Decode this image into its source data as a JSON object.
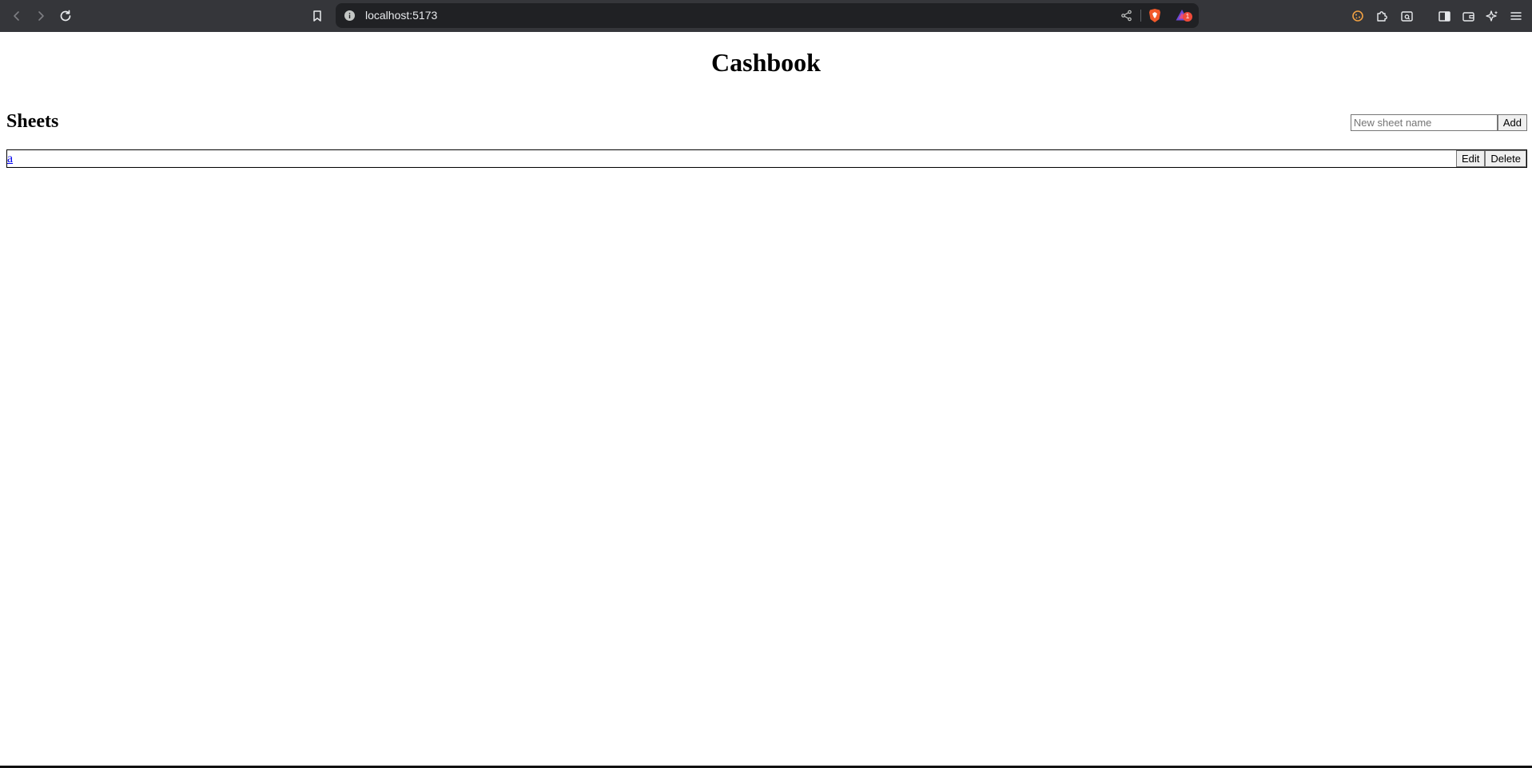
{
  "browser": {
    "url": "localhost:5173",
    "notification_count": "1"
  },
  "app": {
    "title": "Cashbook"
  },
  "sheets_section": {
    "heading": "Sheets",
    "new_sheet_placeholder": "New sheet name",
    "new_sheet_value": "",
    "add_label": "Add"
  },
  "sheets": [
    {
      "name": "a",
      "edit_label": "Edit",
      "delete_label": "Delete"
    }
  ],
  "colors": {
    "chrome_bg": "#35363a",
    "urlbar_bg": "#202124",
    "link": "#0000ee"
  }
}
